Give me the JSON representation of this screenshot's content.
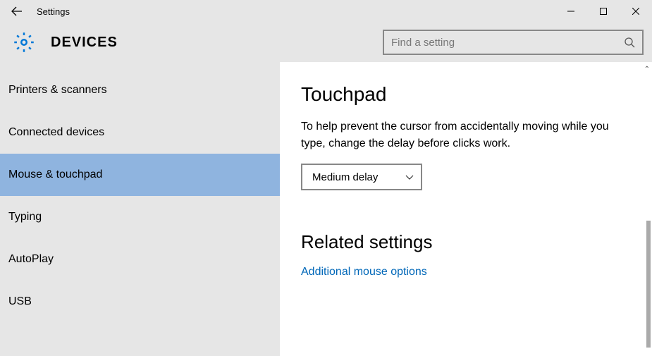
{
  "titlebar": {
    "title": "Settings"
  },
  "header": {
    "page_title": "DEVICES"
  },
  "search": {
    "placeholder": "Find a setting"
  },
  "sidebar": {
    "items": [
      {
        "label": "Printers & scanners",
        "active": false
      },
      {
        "label": "Connected devices",
        "active": false
      },
      {
        "label": "Mouse & touchpad",
        "active": true
      },
      {
        "label": "Typing",
        "active": false
      },
      {
        "label": "AutoPlay",
        "active": false
      },
      {
        "label": "USB",
        "active": false
      }
    ]
  },
  "content": {
    "section_title": "Touchpad",
    "section_desc": "To help prevent the cursor from accidentally moving while you type, change the delay before clicks work.",
    "dropdown_value": "Medium delay",
    "related_title": "Related settings",
    "link_text": "Additional mouse options"
  }
}
